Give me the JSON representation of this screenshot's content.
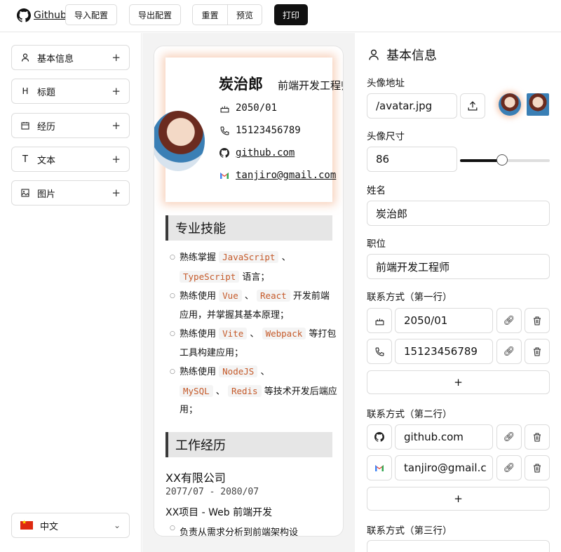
{
  "topbar": {
    "github_label": "Github",
    "import_label": "导入配置",
    "export_label": "导出配置",
    "reset_label": "重置",
    "preview_label": "预览",
    "print_label": "打印"
  },
  "sidebar": {
    "items": [
      {
        "label": "基本信息",
        "icon": "user-icon"
      },
      {
        "label": "标题",
        "icon": "heading-icon"
      },
      {
        "label": "经历",
        "icon": "calendar-icon"
      },
      {
        "label": "文本",
        "icon": "text-icon"
      },
      {
        "label": "图片",
        "icon": "image-icon"
      }
    ],
    "add_symbol": "+",
    "language": "中文"
  },
  "resume": {
    "name": "炭治郎",
    "position": "前端开发工程师",
    "contacts": [
      {
        "icon": "cake-icon",
        "text": "2050/01"
      },
      {
        "icon": "phone-icon",
        "text": "15123456789"
      },
      {
        "icon": "github-icon",
        "text": "github.com"
      },
      {
        "icon": "gmail-icon",
        "text": "tanjiro@gmail.com"
      }
    ],
    "section_skills": "专业技能",
    "skills": {
      "s1_a": "熟练掌握",
      "s1_code1": "JavaScript",
      "s1_sep": "、",
      "s1_code2": "TypeScript",
      "s1_b": "语言；",
      "s2_a": "熟练使用",
      "s2_code1": "Vue",
      "s2_sep": "、",
      "s2_code2": "React",
      "s2_b": "开发前端应用，并掌握其基本原理；",
      "s3_a": "熟练使用",
      "s3_code1": "Vite",
      "s3_sep": "、",
      "s3_code2": "Webpack",
      "s3_b": "等打包工具构建应用；",
      "s4_a": "熟练使用",
      "s4_code1": "NodeJS",
      "s4_sep": "、",
      "s4_code2": "MySQL",
      "s4_sep2": "、",
      "s4_code3": "Redis",
      "s4_b": "等技术开发后端应用；"
    },
    "section_work": "工作经历",
    "company": "XX有限公司",
    "period": "2077/07 - 2080/07",
    "project": "XX项目 - Web 前端开发",
    "bullet": "负责从需求分析到前端架构设"
  },
  "panel": {
    "title": "基本信息",
    "avatar_url_label": "头像地址",
    "avatar_url": "/avatar.jpg",
    "avatar_size_label": "头像尺寸",
    "avatar_size": "86",
    "avatar_size_slider": 0.47,
    "name_label": "姓名",
    "name": "炭治郎",
    "position_label": "职位",
    "position": "前端开发工程师",
    "row1_label": "联系方式（第一行）",
    "row1": [
      {
        "icon": "cake-icon",
        "value": "2050/01"
      },
      {
        "icon": "phone-icon",
        "value": "15123456789"
      }
    ],
    "row2_label": "联系方式（第二行）",
    "row2": [
      {
        "icon": "github-icon",
        "value": "github.com"
      },
      {
        "icon": "gmail-icon",
        "value": "tanjiro@gmail.c"
      }
    ],
    "row3_label": "联系方式（第三行）",
    "add_symbol": "+"
  }
}
